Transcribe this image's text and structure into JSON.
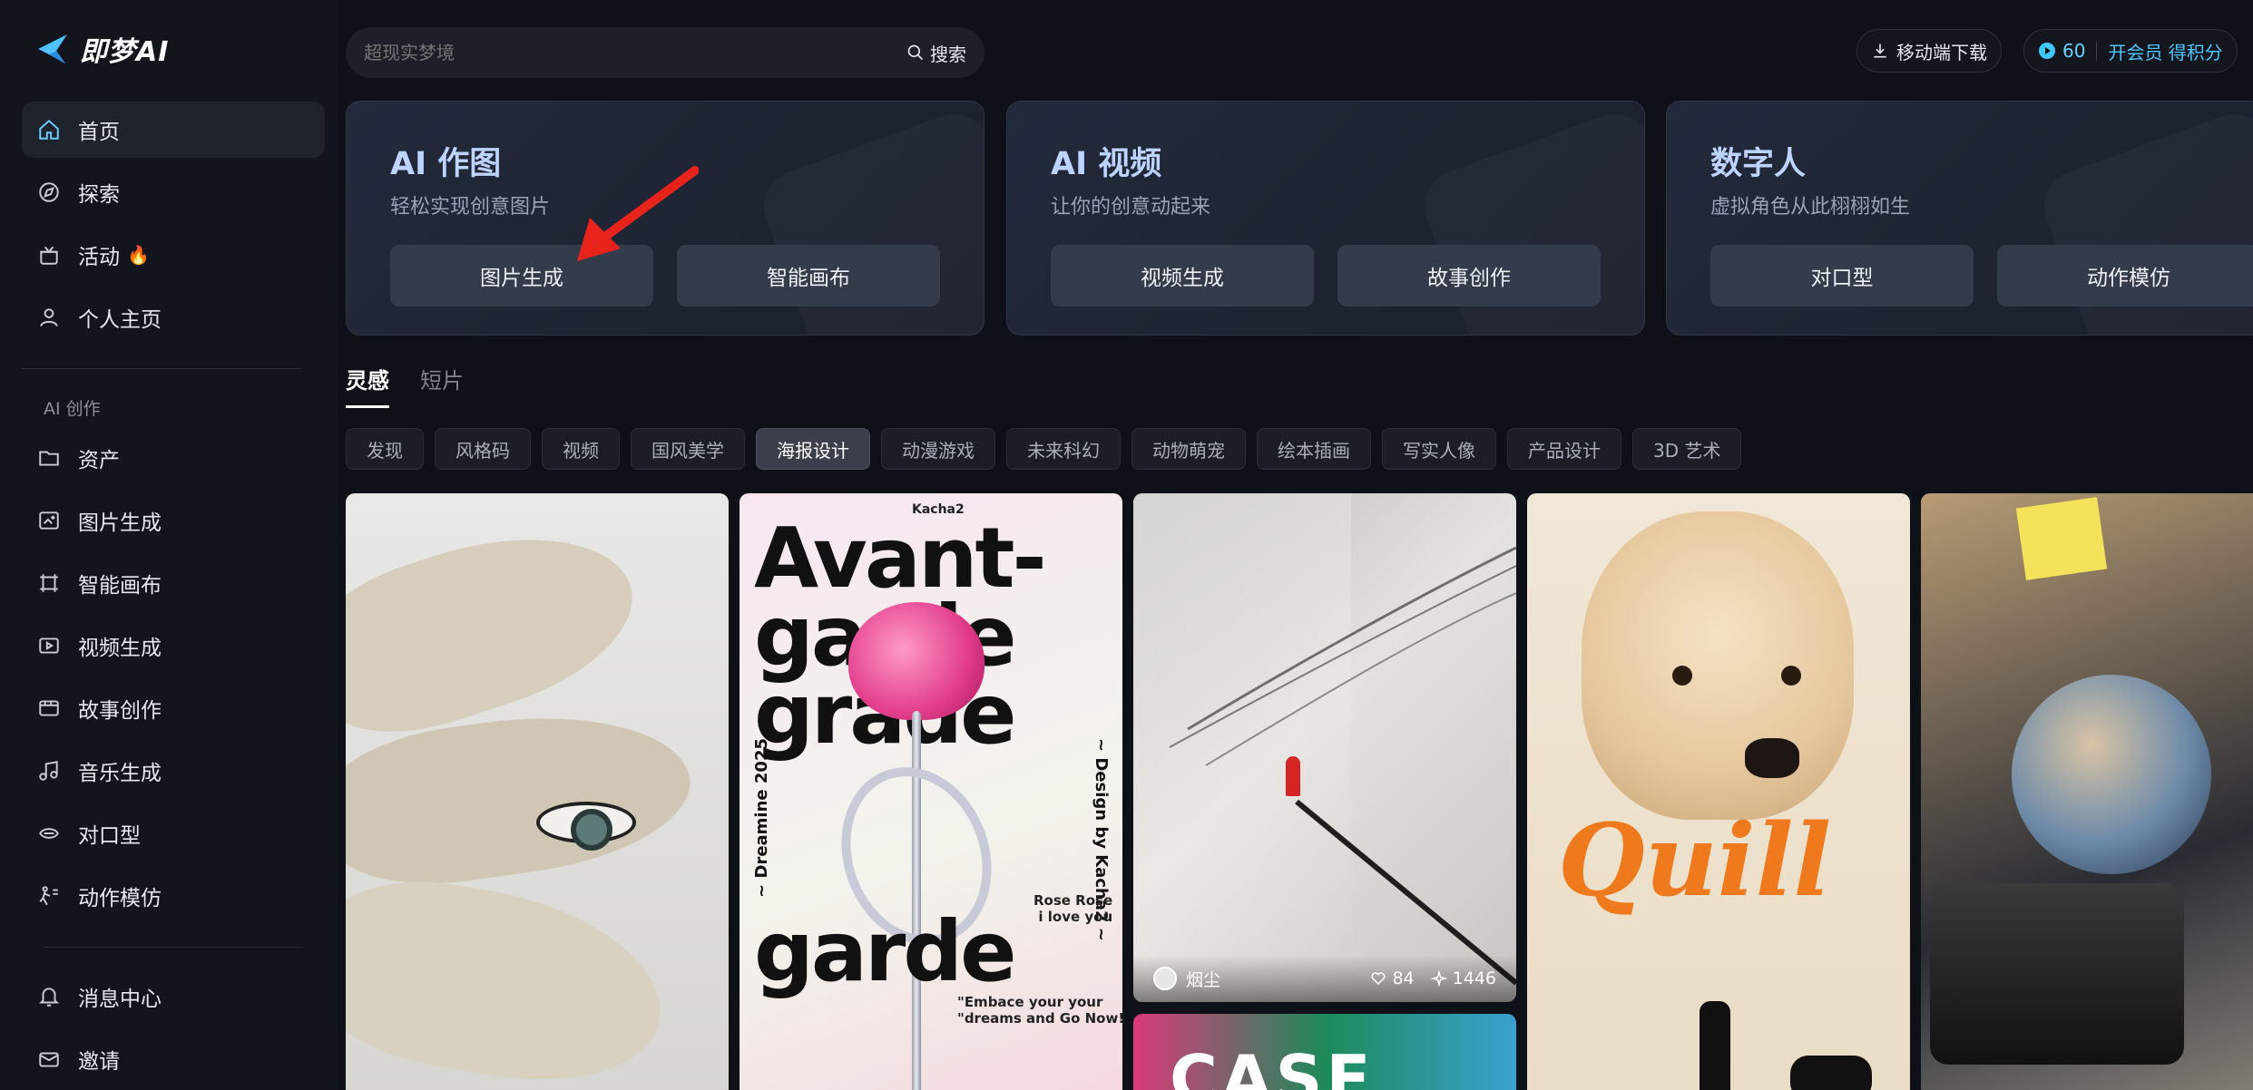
{
  "app": {
    "brand": "即梦AI"
  },
  "sidebar": {
    "items": [
      {
        "label": "首页",
        "icon": "home-icon"
      },
      {
        "label": "探索",
        "icon": "compass-icon"
      },
      {
        "label": "活动",
        "icon": "gift-icon",
        "badge": "🔥"
      },
      {
        "label": "个人主页",
        "icon": "user-icon"
      }
    ],
    "section_label": "AI 创作",
    "creation_items": [
      {
        "label": "资产",
        "icon": "folder-icon"
      },
      {
        "label": "图片生成",
        "icon": "image-gen-icon"
      },
      {
        "label": "智能画布",
        "icon": "canvas-icon"
      },
      {
        "label": "视频生成",
        "icon": "video-gen-icon"
      },
      {
        "label": "故事创作",
        "icon": "story-icon"
      },
      {
        "label": "音乐生成",
        "icon": "music-icon"
      },
      {
        "label": "对口型",
        "icon": "lipsync-icon"
      },
      {
        "label": "动作模仿",
        "icon": "motion-icon"
      }
    ],
    "bottom_items": [
      {
        "label": "消息中心",
        "icon": "bell-icon"
      },
      {
        "label": "邀请",
        "icon": "invite-icon"
      }
    ]
  },
  "search": {
    "placeholder": "超现实梦境",
    "button_label": "搜索"
  },
  "header": {
    "download_label": "移动端下载",
    "credits_value": "60",
    "membership_label": "开会员 得积分"
  },
  "features": [
    {
      "title": "AI 作图",
      "subtitle": "轻松实现创意图片",
      "buttons": [
        "图片生成",
        "智能画布"
      ]
    },
    {
      "title": "AI 视频",
      "subtitle": "让你的创意动起来",
      "buttons": [
        "视频生成",
        "故事创作"
      ]
    },
    {
      "title": "数字人",
      "subtitle": "虚拟角色从此栩栩如生",
      "buttons": [
        "对口型",
        "动作模仿"
      ]
    }
  ],
  "tabs": [
    "灵感",
    "短片"
  ],
  "chips": [
    "发现",
    "风格码",
    "视频",
    "国风美学",
    "海报设计",
    "动漫游戏",
    "未来科幻",
    "动物萌宠",
    "绘本插画",
    "写实人像",
    "产品设计",
    "3D 艺术"
  ],
  "chip_active": "海报设计",
  "gallery": {
    "poster2": {
      "top_label": "Kacha2",
      "big_lines": [
        "Avant-",
        "garde",
        "grade",
        "garde"
      ],
      "left_vertical": "~ Dreamine 2025",
      "right_vertical": "~ Design by Kacha2 ~",
      "side_note": "Rose Rose\ni love you",
      "quote": "\"Embace your your\n\"dreams and Go Now!"
    },
    "card3": {
      "author": "烟尘",
      "likes": "84",
      "remixes": "1446"
    },
    "card3b": {
      "text": "CASE"
    },
    "card4": {
      "word": "Quill"
    }
  }
}
